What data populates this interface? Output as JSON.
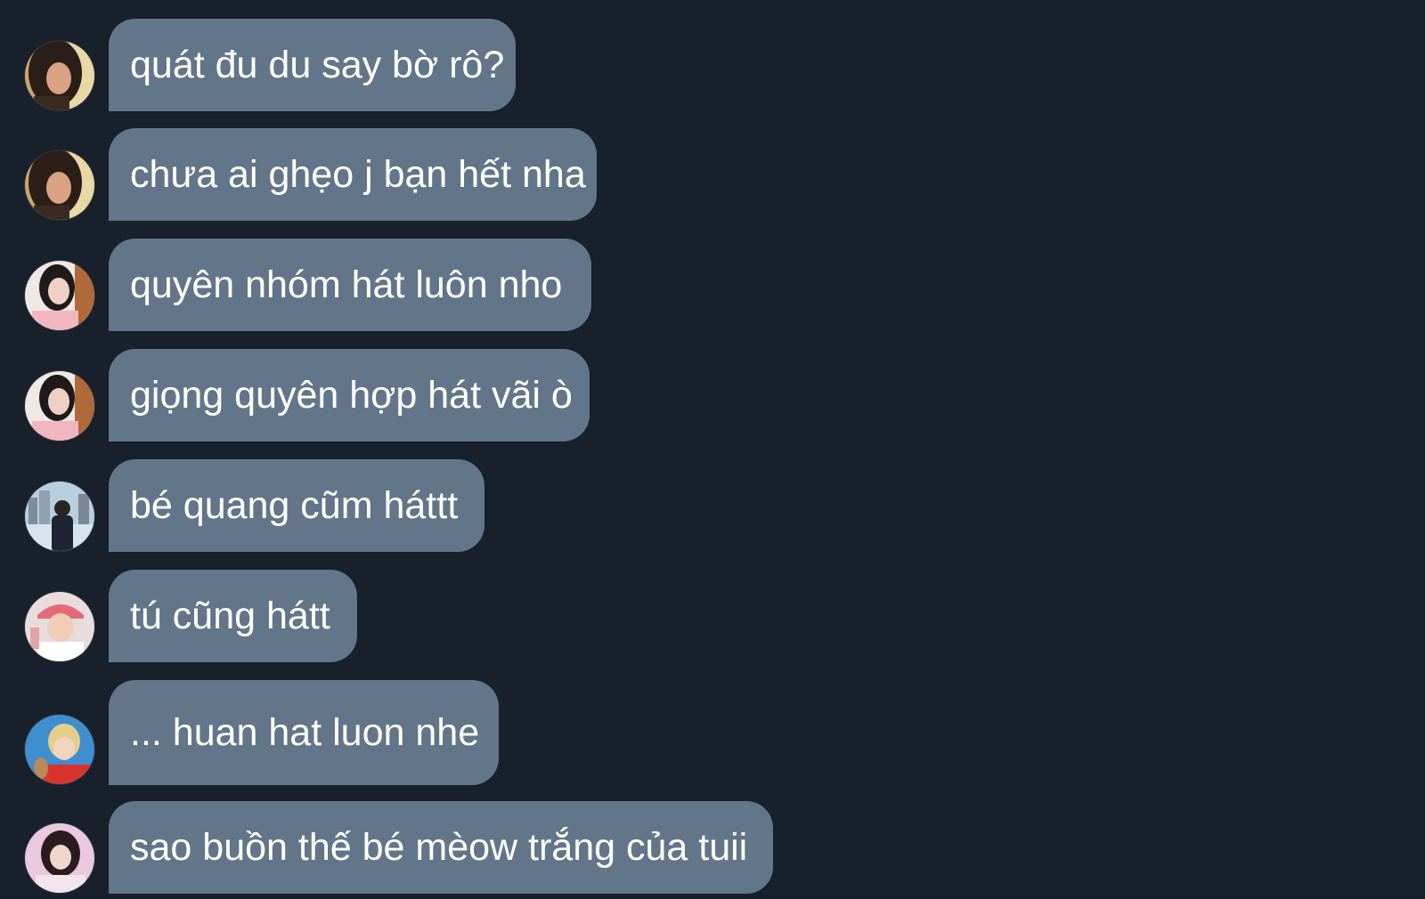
{
  "messages": [
    {
      "text": "quát đu du say bờ rô?",
      "avatar": "avatar-girl-dark-hair"
    },
    {
      "text": "chưa ai ghẹo j bạn hết nha",
      "avatar": "avatar-girl-dark-hair"
    },
    {
      "text": "quyên nhóm hát luôn nho",
      "avatar": "avatar-girl-pink-sweater"
    },
    {
      "text": "giọng quyên hợp hát vãi ò",
      "avatar": "avatar-girl-pink-sweater"
    },
    {
      "text": "bé quang cũm háttt",
      "avatar": "avatar-boy-city-background"
    },
    {
      "text": "tú cũng hátt",
      "avatar": "avatar-boy-pink-cap"
    },
    {
      "text": "... huan hat luon nhe",
      "avatar": "avatar-blond-boy-red-shirt"
    },
    {
      "text": "sao buồn thế bé mèow trắng của tuii",
      "avatar": "avatar-girl-pink-background"
    }
  ],
  "colors": {
    "background": "#17202b",
    "bubble": "#637689",
    "text": "#ffffff"
  }
}
